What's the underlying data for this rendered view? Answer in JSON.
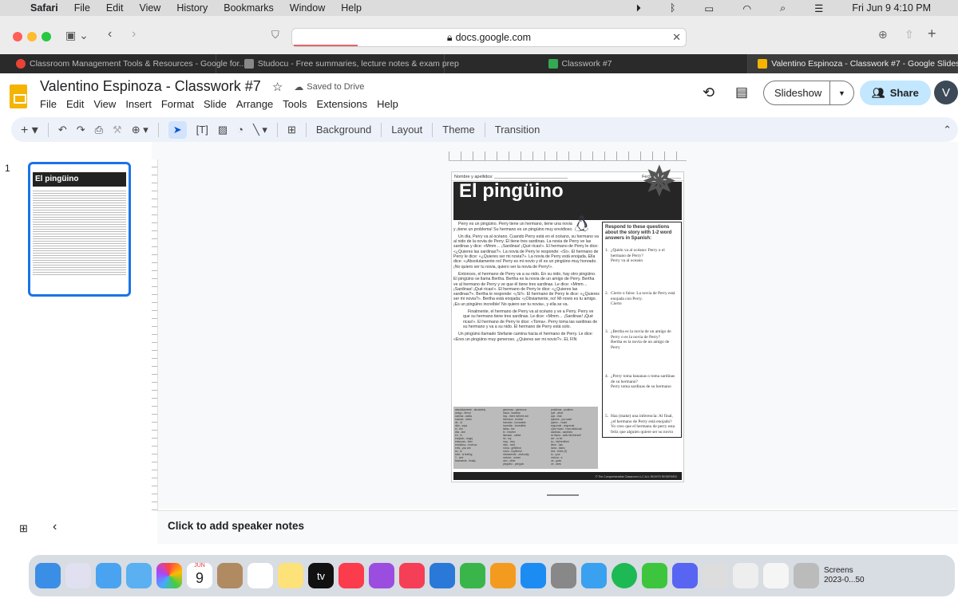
{
  "menubar": {
    "apple": "",
    "items": [
      "Safari",
      "File",
      "Edit",
      "View",
      "History",
      "Bookmarks",
      "Window",
      "Help"
    ],
    "clock": "Fri Jun 9  4:10 PM"
  },
  "safari": {
    "url": "docs.google.com"
  },
  "tabs": [
    {
      "label": "Classroom Management Tools & Resources - Google for...",
      "color": "#ea4335"
    },
    {
      "label": "Studocu - Free summaries, lecture notes & exam prep",
      "color": "#555555"
    },
    {
      "label": "Classwork #7",
      "color": "#34a853"
    },
    {
      "label": "Valentino Espinoza - Classwork #7 - Google Slides",
      "color": "#f4b400",
      "selected": true
    }
  ],
  "doc": {
    "title": "Valentino Espinoza - Classwork #7",
    "saved": "Saved to Drive",
    "menus": [
      "File",
      "Edit",
      "View",
      "Insert",
      "Format",
      "Slide",
      "Arrange",
      "Tools",
      "Extensions",
      "Help"
    ],
    "slideshow": "Slideshow",
    "share": "Share",
    "avatar": "V"
  },
  "toolbar": {
    "background": "Background",
    "layout": "Layout",
    "theme": "Theme",
    "transition": "Transition"
  },
  "filmstrip": {
    "slide_number": "1"
  },
  "slide": {
    "name_label": "Nombre y apellidos: ______________________________",
    "date_label": "Fecha: __________",
    "title": "El pingüino",
    "story": [
      "Perry es un pingüino. Perry tiene un hermano, tiene una novia y ¡tiene un problema! Su hermano es un pingüino muy envidioso.",
      "Un día, Perry va al océano. Cuando Perry está en el océano, su hermano va al nido de la novia de Perry. Él tiene tres sardinas. La novia de Perry ve las sardinas y dice: «Mmm… ¡Sardinas! ¡Qué ricas!». El hermano de Perry le dice: «¿Quieres las sardinas?». La novia de Perry le responde: «Sí». El hermano de Perry le dice: «¿Quieres ser mi novia?». La novia de Perry está enojada. Ella dice: «¡Absolutamente no! Perry es mi novio y él es un pingüino muy honrado. ¡No quiero ser tu novia, quiero ser la novia de Perry!».",
      "Entonces, el hermano de Perry va a su nido. En su nido, hay otro pingüino. El pingüino se llama Bertha. Bertha es la novia de un amigo de Perry. Bertha ve al hermano de Perry y ve que él tiene tres sardinas. Le dice: «Mmm… ¡Sardinas! ¡Qué ricas!». El hermano de Perry le dice: «¿Quieres las sardinas?». Bertha le responde: «¡Sí!». El hermano de Perry le dice: «¿Quieres ser mi novia?». Bertha está enojada: «¡Obviamente, no! Mi novio es tu amigo. ¡Es un pingüino increíble! No quiero ser tu novia», y ella se va.",
      "Finalmente, el hermano de Perry va al océano y ve a Perry. Perry ve que su hermano tiene tres sardinas. Le dice: «Mmm… ¡Sardinas! ¡Qué ricas!». El hermano de Perry le dice: «Toma». Perry toma las sardinas de su hermano y va a su nido. El hermano de Perry está solo.",
      "Un pingüino llamado Stefanie camina hacia el hermano de Perry. Le dice: «Eres un pingüino muy generoso. ¿Quieres ser mi novio?». EL FIN"
    ],
    "vocab": [
      [
        "absolutamente - absolutely",
        "amigo - friend",
        "camina - walks",
        "cuando - when",
        "de - of",
        "dice - says",
        "el - the",
        "ella - she",
        "en - in",
        "enojado - angry",
        "entonces - then",
        "envidioso - envious",
        "eres - you are",
        "es - is",
        "está - is feeling",
        "Y - and",
        "finalmente - finally"
      ],
      [
        "generoso - generous",
        "hacia - towards",
        "hay - there is/there are",
        "hermano - brother",
        "honrado - honorable",
        "increíble - incredible",
        "la/las - the",
        "le - him/her",
        "llamado - called",
        "mi - my",
        "muy - very",
        "nido - nest",
        "novia - girlfriend",
        "novio - boyfriend",
        "obviamente - obviously",
        "océano - ocean",
        "otro - other",
        "pingüino - penguin"
      ],
      [
        "problema - problem",
        "qué - what",
        "que - that",
        "quieres - you want",
        "quiero - I want",
        "responde - responds",
        "¡Qué ricas! - How delicious!",
        "sardinas - sardines",
        "se llama - calls him/herself",
        "ser - to be",
        "su - his/her/their",
        "tiene - has",
        "toma - takes",
        "tres - three (3)",
        "tu - your",
        "un/una - a",
        "va - goes",
        "ve - sees"
      ]
    ],
    "questions_header": "Respond to these questions about the story with 1-2 word answers in Spanish:",
    "questions": [
      {
        "n": "1.",
        "q": "¿Quién va al océano: Perry o el hermano de Perry?",
        "a": "Perry va al oceano"
      },
      {
        "n": "2.",
        "q": "Cierto o falso: La novia de Perry está enojada con Perry.",
        "a": "Cierto"
      },
      {
        "n": "3.",
        "q": "¿Bertha es la novia de un amigo de Perry o es la novia de Perry?",
        "a": "Bertha es la novia de un amigo de Perry"
      },
      {
        "n": "4.",
        "q": "¿Perry toma bananas o toma sardinas de su hermano?",
        "a": "Perry toma sardinas de su hermano"
      },
      {
        "n": "5.",
        "q": "Haz (make) una inferencia: Al final, ¿el hermano de Perry está enojado?",
        "a": "Yo creo que el hermano de perry esta feliz que alguien quiere ser su novio"
      }
    ],
    "footer": "© The Comprehensible Classroom LLC ALL RIGHTS RESERVED"
  },
  "notes": {
    "placeholder": "Click to add speaker notes"
  },
  "dock": {
    "calendar_month": "JUN",
    "calendar_day": "9",
    "tv": "tv",
    "screenshot_label": "Screens\n2023-0...50"
  }
}
